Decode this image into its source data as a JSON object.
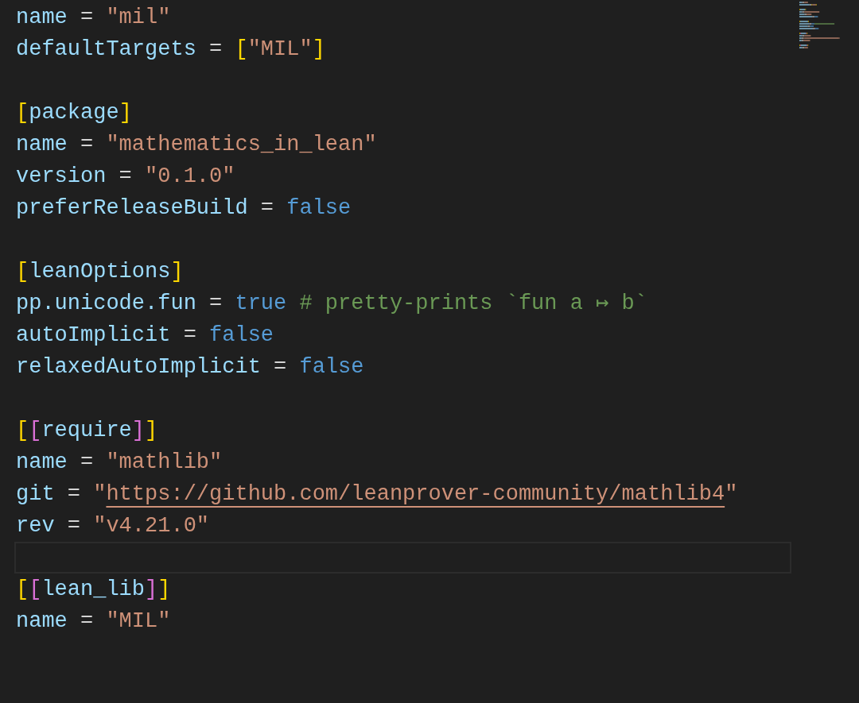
{
  "editor": {
    "lines": [
      {
        "current": false,
        "tokens": [
          {
            "kind": "key",
            "text": "name"
          },
          {
            "kind": "op",
            "text": " = "
          },
          {
            "kind": "string",
            "text": "\"mil\""
          }
        ]
      },
      {
        "current": false,
        "tokens": [
          {
            "kind": "key",
            "text": "defaultTargets"
          },
          {
            "kind": "op",
            "text": " = "
          },
          {
            "kind": "bracket1",
            "text": "["
          },
          {
            "kind": "string",
            "text": "\"MIL\""
          },
          {
            "kind": "bracket1",
            "text": "]"
          }
        ]
      },
      {
        "current": false
      },
      {
        "current": false,
        "tokens": [
          {
            "kind": "bracket1",
            "text": "["
          },
          {
            "kind": "key",
            "text": "package"
          },
          {
            "kind": "bracket1",
            "text": "]"
          }
        ]
      },
      {
        "current": false,
        "tokens": [
          {
            "kind": "key",
            "text": "name"
          },
          {
            "kind": "op",
            "text": " = "
          },
          {
            "kind": "string",
            "text": "\"mathematics_in_lean\""
          }
        ]
      },
      {
        "current": false,
        "tokens": [
          {
            "kind": "key",
            "text": "version"
          },
          {
            "kind": "op",
            "text": " = "
          },
          {
            "kind": "string",
            "text": "\"0.1.0\""
          }
        ]
      },
      {
        "current": false,
        "tokens": [
          {
            "kind": "key",
            "text": "preferReleaseBuild"
          },
          {
            "kind": "op",
            "text": " = "
          },
          {
            "kind": "bool",
            "text": "false"
          }
        ]
      },
      {
        "current": false
      },
      {
        "current": false,
        "tokens": [
          {
            "kind": "bracket1",
            "text": "["
          },
          {
            "kind": "key",
            "text": "leanOptions"
          },
          {
            "kind": "bracket1",
            "text": "]"
          }
        ]
      },
      {
        "current": false,
        "tokens": [
          {
            "kind": "key",
            "text": "pp.unicode.fun"
          },
          {
            "kind": "op",
            "text": " = "
          },
          {
            "kind": "bool",
            "text": "true"
          },
          {
            "kind": "comment",
            "text": " # pretty-prints `fun a ↦ b`"
          }
        ]
      },
      {
        "current": false,
        "tokens": [
          {
            "kind": "key",
            "text": "autoImplicit"
          },
          {
            "kind": "op",
            "text": " = "
          },
          {
            "kind": "bool",
            "text": "false"
          }
        ]
      },
      {
        "current": false,
        "tokens": [
          {
            "kind": "key",
            "text": "relaxedAutoImplicit"
          },
          {
            "kind": "op",
            "text": " = "
          },
          {
            "kind": "bool",
            "text": "false"
          }
        ]
      },
      {
        "current": false
      },
      {
        "current": false,
        "tokens": [
          {
            "kind": "bracket1",
            "text": "["
          },
          {
            "kind": "bracket2",
            "text": "["
          },
          {
            "kind": "key",
            "text": "require"
          },
          {
            "kind": "bracket2",
            "text": "]"
          },
          {
            "kind": "bracket1",
            "text": "]"
          }
        ]
      },
      {
        "current": false,
        "tokens": [
          {
            "kind": "key",
            "text": "name"
          },
          {
            "kind": "op",
            "text": " = "
          },
          {
            "kind": "string",
            "text": "\"mathlib\""
          }
        ]
      },
      {
        "current": false,
        "tokens": [
          {
            "kind": "key",
            "text": "git"
          },
          {
            "kind": "op",
            "text": " = "
          },
          {
            "kind": "string",
            "text": "\""
          },
          {
            "kind": "link",
            "text": "https://github.com/leanprover-community/mathlib4"
          },
          {
            "kind": "string",
            "text": "\""
          }
        ]
      },
      {
        "current": false,
        "tokens": [
          {
            "kind": "key",
            "text": "rev"
          },
          {
            "kind": "op",
            "text": " = "
          },
          {
            "kind": "string",
            "text": "\"v4.21.0\""
          }
        ]
      },
      {
        "current": true
      },
      {
        "current": false,
        "tokens": [
          {
            "kind": "bracket1",
            "text": "["
          },
          {
            "kind": "bracket2",
            "text": "["
          },
          {
            "kind": "key",
            "text": "lean_lib"
          },
          {
            "kind": "bracket2",
            "text": "]"
          },
          {
            "kind": "bracket1",
            "text": "]"
          }
        ]
      },
      {
        "current": false,
        "tokens": [
          {
            "kind": "key",
            "text": "name"
          },
          {
            "kind": "op",
            "text": " = "
          },
          {
            "kind": "string",
            "text": "\"MIL\""
          }
        ]
      }
    ]
  }
}
